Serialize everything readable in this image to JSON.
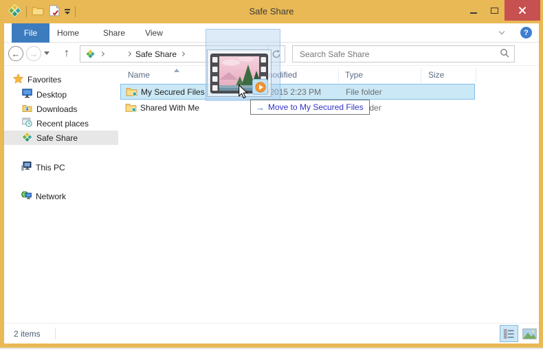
{
  "colors": {
    "gold": "#E9B955",
    "tabBlue": "#3D7BBF",
    "closeRed": "#C75050",
    "selBg": "#CBE8F6",
    "selBorder": "#7FC0EC",
    "tooltipText": "#3333C6",
    "arrowBlue": "#2F6BD4",
    "headerText": "#5B6B84",
    "grayText": "#6D6D6D",
    "darkText": "#1E1E1E",
    "ctrlBorder": "#C9C9C9"
  },
  "titlebar": {
    "title": "Safe Share"
  },
  "ribbon": {
    "tabs": [
      {
        "label": "File",
        "active": true
      },
      {
        "label": "Home",
        "active": false
      },
      {
        "label": "Share",
        "active": false
      },
      {
        "label": "View",
        "active": false
      }
    ]
  },
  "navbar": {
    "breadcrumb_location": "Safe Share",
    "search_placeholder": "Search Safe Share"
  },
  "sidebar": {
    "favorites_label": "Favorites",
    "favorites_items": [
      "Desktop",
      "Downloads",
      "Recent places",
      "Safe Share"
    ],
    "selected_item": "Safe Share",
    "this_pc_label": "This PC",
    "network_label": "Network"
  },
  "files": {
    "columns": [
      "Name",
      "Date modified",
      "Type",
      "Size"
    ],
    "sort_column": "Name",
    "sort_direction": "ascending",
    "rows": [
      {
        "name": "My Secured Files",
        "date_modified": "26/08/2015 2:23 PM",
        "type": "File folder",
        "size": "",
        "selected": true
      },
      {
        "name": "Shared With Me",
        "date_modified": "",
        "type": "File folder",
        "size": "",
        "selected": false
      }
    ]
  },
  "drag": {
    "move_tooltip": "Move to My Secured Files",
    "dragged_item": "video file thumbnail"
  },
  "statusbar": {
    "items_count": "2 items"
  },
  "icons": {
    "move_arrow": "→",
    "back_arrow": "←",
    "forward_arrow": "→",
    "up_arrow": "↑",
    "help": "?",
    "app_logo": "four-diamond clover (yellow/green/teal)",
    "search": "magnifier",
    "refresh": "circular arrow"
  }
}
